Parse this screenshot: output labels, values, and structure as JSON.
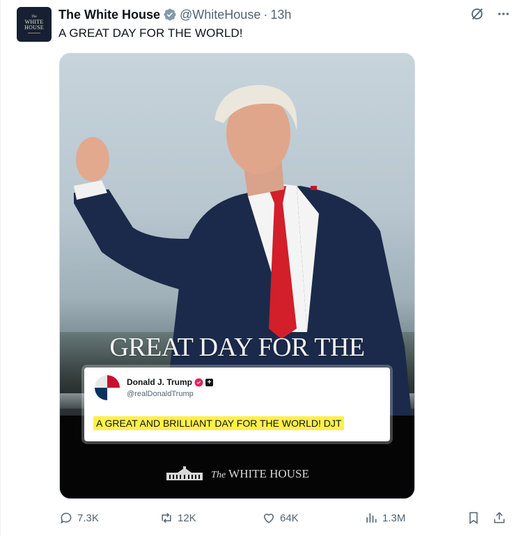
{
  "post": {
    "account_name": "The White House",
    "handle": "@WhiteHouse",
    "separator": "·",
    "time": "13h",
    "text": "A GREAT DAY FOR THE WORLD!",
    "avatar": {
      "line1": "The",
      "line2": "WHITE",
      "line3": "HOUSE"
    }
  },
  "media": {
    "overlay_title": "GREAT DAY FOR THE WORLD",
    "quote": {
      "name": "Donald J. Trump",
      "handle": "@realDonaldTrump",
      "text": "A GREAT AND BRILLIANT DAY FOR THE WORLD! DJT"
    },
    "brand": {
      "the": "The",
      "name": "WHITE HOUSE"
    }
  },
  "actions": {
    "replies": "7.3K",
    "reposts": "12K",
    "likes": "64K",
    "views": "1.3M"
  },
  "colors": {
    "verified_badge": "#829aab",
    "tie": "#d21f2a",
    "suit": "#1b2a4a",
    "highlight": "#fff04a",
    "muted": "#536471"
  },
  "icons": [
    "verified-icon",
    "grok-icon",
    "more-icon",
    "reply-icon",
    "repost-icon",
    "like-icon",
    "views-icon",
    "bookmark-icon",
    "share-icon"
  ]
}
